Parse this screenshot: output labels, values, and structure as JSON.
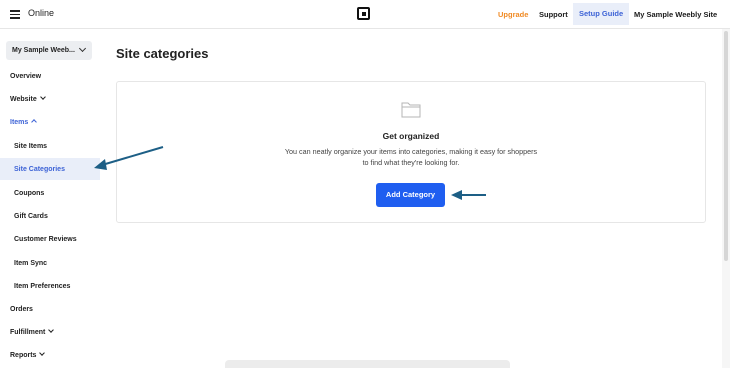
{
  "topbar": {
    "app_name": "Online",
    "upgrade": "Upgrade",
    "support": "Support",
    "setup_guide": "Setup Guide",
    "site_name": "My Sample Weebly Site"
  },
  "sidebar": {
    "site_select": "My Sample Weeb...",
    "items": {
      "overview": "Overview",
      "website": "Website",
      "items": "Items",
      "site_items": "Site Items",
      "site_categories": "Site Categories",
      "coupons": "Coupons",
      "gift_cards": "Gift Cards",
      "customer_reviews": "Customer Reviews",
      "item_sync": "Item Sync",
      "item_preferences": "Item Preferences",
      "orders": "Orders",
      "fulfillment": "Fulfillment",
      "reports": "Reports"
    }
  },
  "main": {
    "title": "Site categories",
    "empty_state": {
      "title": "Get organized",
      "description": "You can neatly organize your items into categories, making it easy for shoppers to find what they're looking for.",
      "button": "Add Category"
    }
  },
  "colors": {
    "accent": "#1f5ef0",
    "active_nav": "#3d63d6",
    "upgrade": "#f08a24",
    "annotation_arrow": "#1d5f86"
  }
}
